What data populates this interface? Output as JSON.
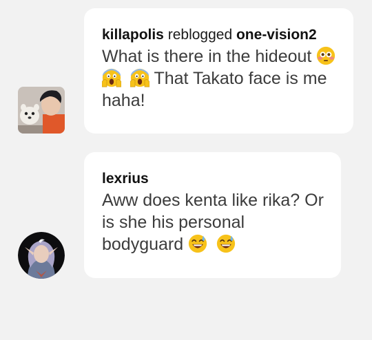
{
  "messages": [
    {
      "username": "killapolis",
      "action": "reblogged",
      "source": "one-vision2",
      "text_before": "What is there in the hideout",
      "text_after": "That Takato face is me haha!",
      "emojis": [
        "flushed-face",
        "screaming-face",
        "screaming-face"
      ]
    },
    {
      "username": "lexrius",
      "text_before": "Aww does kenta like rika? Or is she his personal bodyguard",
      "emojis": [
        "grinning-sweat-face",
        "grinning-sweat-face"
      ]
    }
  ]
}
